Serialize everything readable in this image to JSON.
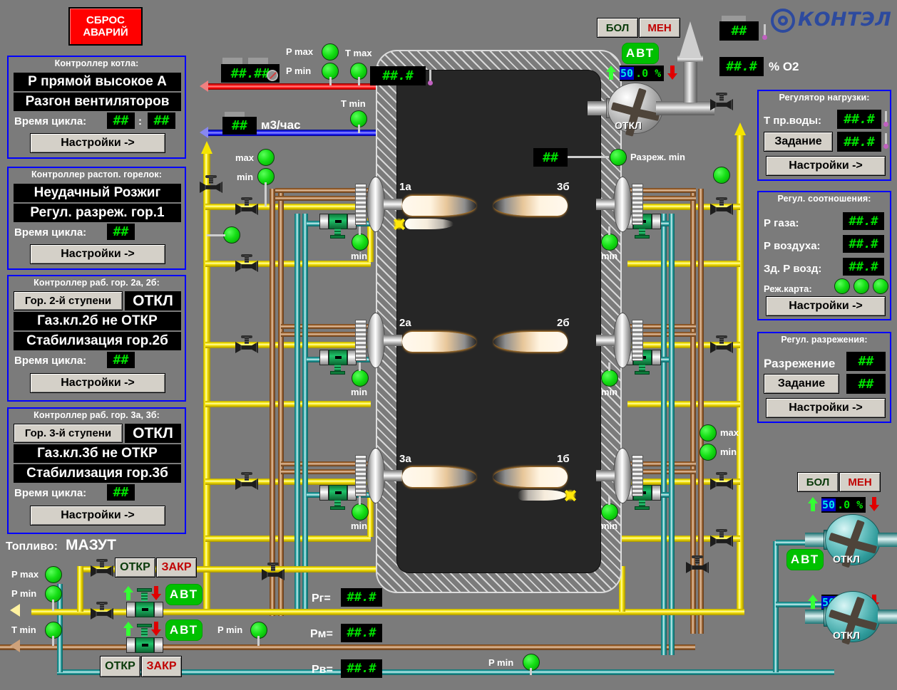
{
  "app": {
    "background_color": "#7b7b7b",
    "accent_blue": "#0000ff",
    "lamp_green": "#00d000",
    "display_green": "#00e000"
  },
  "logo": {
    "name": "КОНТЭЛ",
    "emblem": "КЭ"
  },
  "alarm_reset_button": {
    "line1": "СБРОС",
    "line2": "АВАРИЙ",
    "color": "#ff0000"
  },
  "left_panels": [
    {
      "id": "boiler-controller",
      "title": "Контроллер котла:",
      "status_lines": [
        "Р прямой высокое А",
        "Разгон вентиляторов"
      ],
      "cycle_label": "Время цикла:",
      "cycle_value_1": "##",
      "cycle_separator": ":",
      "cycle_value_2": "##",
      "settings_button": "Настройки ->"
    },
    {
      "id": "ignition-burner-controller",
      "title": "Контроллер растоп. горелок:",
      "status_lines": [
        "Неудачный Розжиг",
        "Регул. разреж. гор.1"
      ],
      "cycle_label": "Время цикла:",
      "cycle_value_1": "##",
      "settings_button": "Настройки ->"
    },
    {
      "id": "burner-controller-2a-2b",
      "title": "Контроллер раб. гор. 2а, 2б:",
      "stage_button": "Гор. 2-й ступени",
      "stage_state": "ОТКЛ",
      "status_lines": [
        "Газ.кл.2б не ОТКР",
        "Стабилизация гор.2б"
      ],
      "cycle_label": "Время цикла:",
      "cycle_value_1": "##",
      "settings_button": "Настройки ->"
    },
    {
      "id": "burner-controller-3a-3b",
      "title": "Контроллер раб. гор. 3а, 3б:",
      "stage_button": "Гор. 3-й ступени",
      "stage_state": "ОТКЛ",
      "status_lines": [
        "Газ.кл.3б не ОТКР",
        "Стабилизация гор.3б"
      ],
      "cycle_label": "Время цикла:",
      "cycle_value_1": "##",
      "settings_button": "Настройки ->"
    }
  ],
  "fuel": {
    "label": "Топливо:",
    "value": "МАЗУТ"
  },
  "right_panels": [
    {
      "id": "load-regulator",
      "title": "Регулятор нагрузки:",
      "row1_label": "Т пр.воды:",
      "row1_value": "##.#",
      "setpoint_button": "Задание",
      "row2_value": "##.#",
      "settings_button": "Настройки ->"
    },
    {
      "id": "ratio-regulator",
      "title": "Регул. соотношения:",
      "rows": [
        {
          "label": "Р газа:",
          "value": "##.#"
        },
        {
          "label": "Р воздуха:",
          "value": "##.#"
        },
        {
          "label": "Зд. Р возд:",
          "value": "##.#"
        }
      ],
      "map_label": "Реж.карта:",
      "map_lamps": 3,
      "settings_button": "Настройки ->"
    },
    {
      "id": "draft-regulator",
      "title": "Регул. разрежения:",
      "row1_label": "Разрежение",
      "row1_value": "##",
      "setpoint_button": "Задание",
      "row2_value": "##",
      "settings_button": "Настройки ->"
    }
  ],
  "top_instruments": {
    "pressure_value": "##.##",
    "flow_value": "##",
    "flow_units": "м3/час",
    "temp_value": "##.#",
    "lamps": [
      {
        "label": "P max"
      },
      {
        "label": "P min"
      },
      {
        "label": "T max"
      },
      {
        "label": "T min"
      }
    ]
  },
  "smoke_fan": {
    "bol_button": "БОЛ",
    "men_button": "МЕН",
    "mode": "АВТ",
    "percent_int": "50",
    "percent_frac": ".0 %",
    "state": "ОТКЛ",
    "draft_lamp_label": "Разреж. min"
  },
  "stack_instruments": {
    "temp_value": "##",
    "o2_value": "##.#",
    "o2_label": "% O2"
  },
  "furnace": {
    "draft_value": "##",
    "burners": [
      "1а",
      "3б",
      "2а",
      "2б",
      "3а",
      "1б"
    ]
  },
  "air_lamps_left": [
    {
      "label": "max"
    },
    {
      "label": "min"
    }
  ],
  "air_lamps_right": [
    {
      "label": "max"
    },
    {
      "label": "min"
    }
  ],
  "burner_min_lamps": {
    "label": "min",
    "count": 6
  },
  "bottom_gas_line": {
    "pmax_label": "P max",
    "pmin_label": "P min",
    "open_button": "ОТКР",
    "close_button": "ЗАКР",
    "mode": "АВТ"
  },
  "bottom_mazut_line": {
    "tmin_label": "T min",
    "pmin_label": "P min",
    "open_button": "ОТКР",
    "close_button": "ЗАКР",
    "mode": "АВТ"
  },
  "pressure_readouts": [
    {
      "label": "Рг=",
      "value": "##.#"
    },
    {
      "label": "Рм=",
      "value": "##.#"
    },
    {
      "label": "Рв=",
      "value": "##.#"
    }
  ],
  "air_pmin_lamp": {
    "label": "P min"
  },
  "blower_fans": {
    "bol_button": "БОЛ",
    "men_button": "МЕН",
    "mode": "АВТ",
    "fan1": {
      "percent_int": "50",
      "percent_frac": ".0 %",
      "state": "ОТКЛ"
    },
    "fan2": {
      "percent_int": "50",
      "percent_frac": ".0 %",
      "state": "ОТКЛ"
    }
  }
}
